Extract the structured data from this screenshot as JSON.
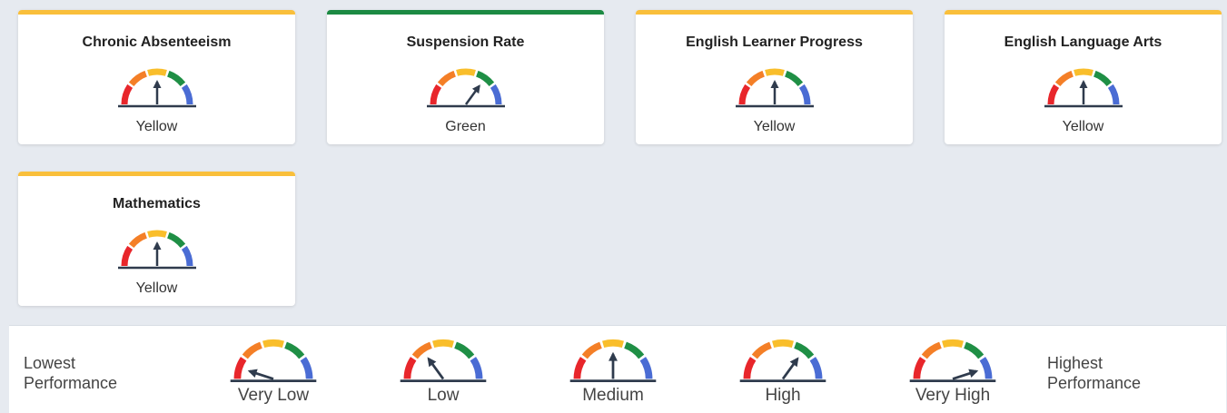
{
  "colors": {
    "red": "#e8262b",
    "orange": "#f47f27",
    "yellow": "#f9be2b",
    "green": "#1f8f45",
    "blue": "#4a6cd4",
    "needle": "#2f3b4d",
    "top_yellow": "#f9bf3b",
    "top_green": "#1c8a43"
  },
  "cards": [
    {
      "title": "Chronic Absenteeism",
      "status": "Yellow",
      "level": 2
    },
    {
      "title": "Suspension Rate",
      "status": "Green",
      "level": 3
    },
    {
      "title": "English Learner Progress",
      "status": "Yellow",
      "level": 2
    },
    {
      "title": "English Language Arts",
      "status": "Yellow",
      "level": 2
    },
    {
      "title": "Mathematics",
      "status": "Yellow",
      "level": 2
    }
  ],
  "legend": {
    "lowest_label": "Lowest\nPerformance",
    "highest_label": "Highest\nPerformance",
    "levels": [
      {
        "label": "Very Low",
        "level": 0
      },
      {
        "label": "Low",
        "level": 1
      },
      {
        "label": "Medium",
        "level": 2
      },
      {
        "label": "High",
        "level": 3
      },
      {
        "label": "Very High",
        "level": 4
      }
    ]
  }
}
